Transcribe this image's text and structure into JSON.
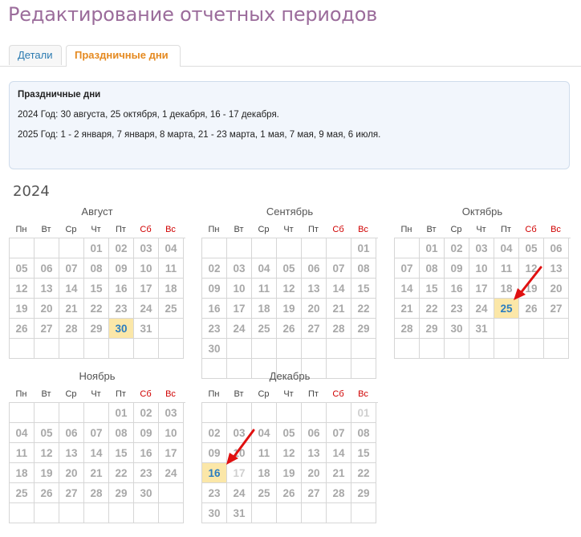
{
  "header": {
    "title": "Редактирование отчетных периодов"
  },
  "tabs": [
    {
      "label": "Детали",
      "active": false
    },
    {
      "label": "Праздничные дни",
      "active": true
    }
  ],
  "holiday_info": {
    "title": "Праздничные дни",
    "lines": [
      "2024 Год: 30 августа, 25 октября, 1 декабря, 16 - 17 декабря.",
      "2025 Год: 1 - 2 января, 7 января, 8 марта, 21 - 23 марта, 1 мая, 7 мая, 9 мая, 6 июля."
    ]
  },
  "calendar": {
    "year": "2024",
    "weekdays": [
      "Пн",
      "Вт",
      "Ср",
      "Чт",
      "Пт",
      "Сб",
      "Вс"
    ],
    "colors": {
      "holiday_bg": "#fbe7a8",
      "holiday_text": "#2b7dc0",
      "weekend": "#d00000",
      "arrow": "#e01010"
    },
    "months": [
      {
        "name": "Август",
        "first_weekday": 3,
        "days": 31,
        "rows": 6,
        "holidays": [
          30
        ],
        "faded": []
      },
      {
        "name": "Сентябрь",
        "first_weekday": 6,
        "days": 30,
        "rows": 7,
        "holidays": [],
        "faded": []
      },
      {
        "name": "Октябрь",
        "first_weekday": 1,
        "days": 31,
        "rows": 6,
        "holidays": [
          25
        ],
        "faded": []
      },
      {
        "name": "Ноябрь",
        "first_weekday": 4,
        "days": 30,
        "rows": 6,
        "holidays": [],
        "faded": []
      },
      {
        "name": "Декабрь",
        "first_weekday": 6,
        "days": 31,
        "rows": 6,
        "holidays": [
          16
        ],
        "faded": [
          1,
          17
        ]
      }
    ]
  }
}
